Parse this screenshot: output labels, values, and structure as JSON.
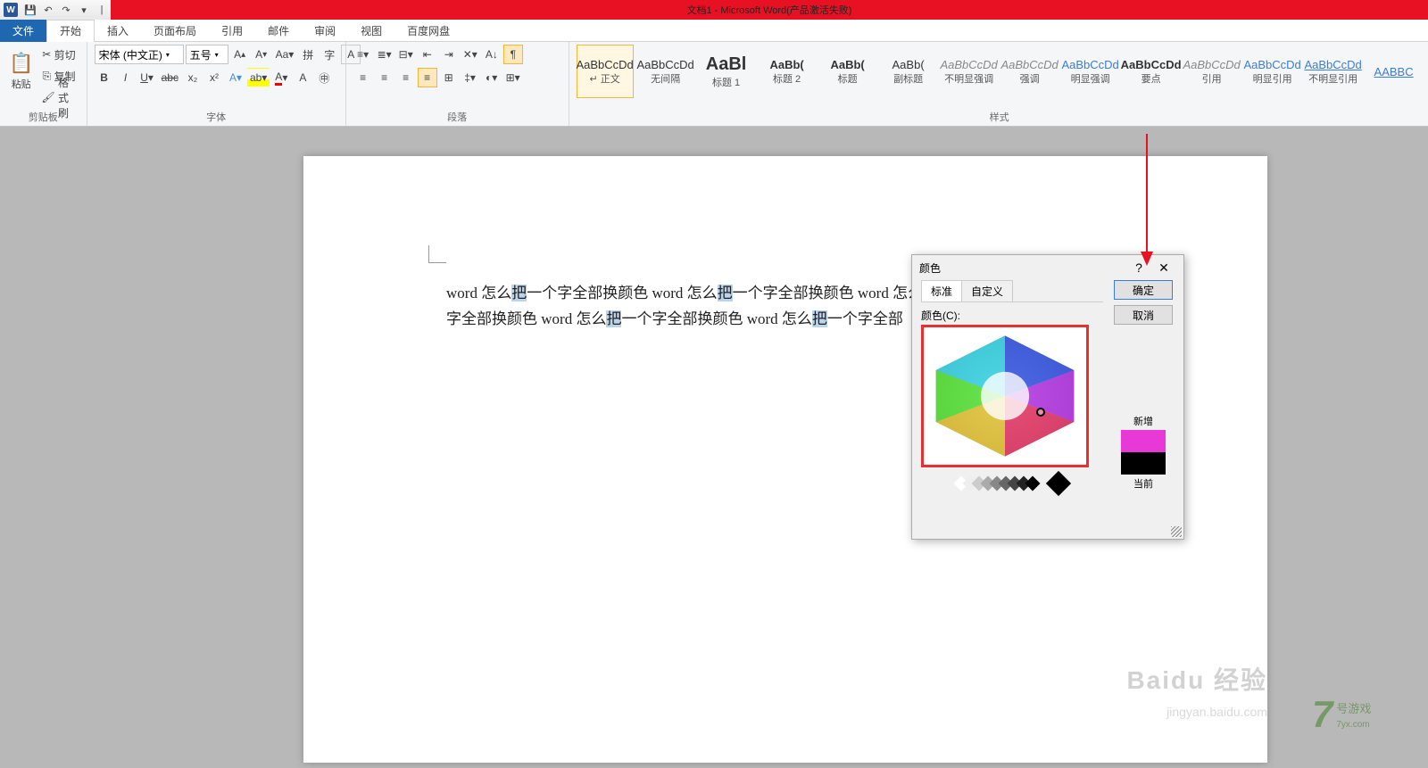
{
  "title_bar": {
    "title": "文档1 - Microsoft Word(产品激活失败)"
  },
  "tabs": {
    "file": "文件",
    "home": "开始",
    "insert": "插入",
    "layout": "页面布局",
    "ref": "引用",
    "mail": "邮件",
    "review": "审阅",
    "view": "视图",
    "baidu": "百度网盘"
  },
  "clipboard": {
    "label": "剪贴板",
    "paste": "粘贴",
    "cut": "剪切",
    "copy": "复制",
    "brush": "格式刷"
  },
  "font": {
    "label": "字体",
    "name": "宋体 (中文正)",
    "size": "五号"
  },
  "para": {
    "label": "段落"
  },
  "styles": {
    "label": "样式",
    "items": [
      {
        "prev": "AaBbCcDd",
        "name": "正文",
        "cls": ""
      },
      {
        "prev": "AaBbCcDd",
        "name": "无间隔",
        "cls": ""
      },
      {
        "prev": "AaBl",
        "name": "标题 1",
        "cls": "big"
      },
      {
        "prev": "AaBb(",
        "name": "标题 2",
        "cls": "bold"
      },
      {
        "prev": "AaBb(",
        "name": "标题",
        "cls": "bold"
      },
      {
        "prev": "AaBb(",
        "name": "副标题",
        "cls": ""
      },
      {
        "prev": "AaBbCcDd",
        "name": "不明显强调",
        "cls": "gray"
      },
      {
        "prev": "AaBbCcDd",
        "name": "强调",
        "cls": "gray"
      },
      {
        "prev": "AaBbCcDd",
        "name": "明显强调",
        "cls": "blue"
      },
      {
        "prev": "AaBbCcDd",
        "name": "要点",
        "cls": "bold"
      },
      {
        "prev": "AaBbCcDd",
        "name": "引用",
        "cls": "gray"
      },
      {
        "prev": "AaBbCcDd",
        "name": "明显引用",
        "cls": "blue"
      },
      {
        "prev": "AaBbCcDd",
        "name": "不明显引用",
        "cls": "ul"
      },
      {
        "prev": "AABBC",
        "name": "",
        "cls": "ul"
      }
    ]
  },
  "doc": {
    "text": "word 怎么把一个字全部换颜色 word 怎么把一个字全部换颜色 word 怎么把一个字全部换颜色 word 怎么把一个字全部换颜色 word 怎么把一个字全部换颜色 word 怎么把一个字全部"
  },
  "dialog": {
    "title": "颜色",
    "tab_std": "标准",
    "tab_cus": "自定义",
    "colors_label": "颜色(C):",
    "ok": "确定",
    "cancel": "取消",
    "new": "新增",
    "current": "当前",
    "new_color": "#e838d8",
    "cur_color": "#000000"
  },
  "watermark": {
    "main": "Baidu 经验",
    "sub": "jingyan.baidu.com",
    "game": "号游戏",
    "game_url": "7yx.com"
  }
}
